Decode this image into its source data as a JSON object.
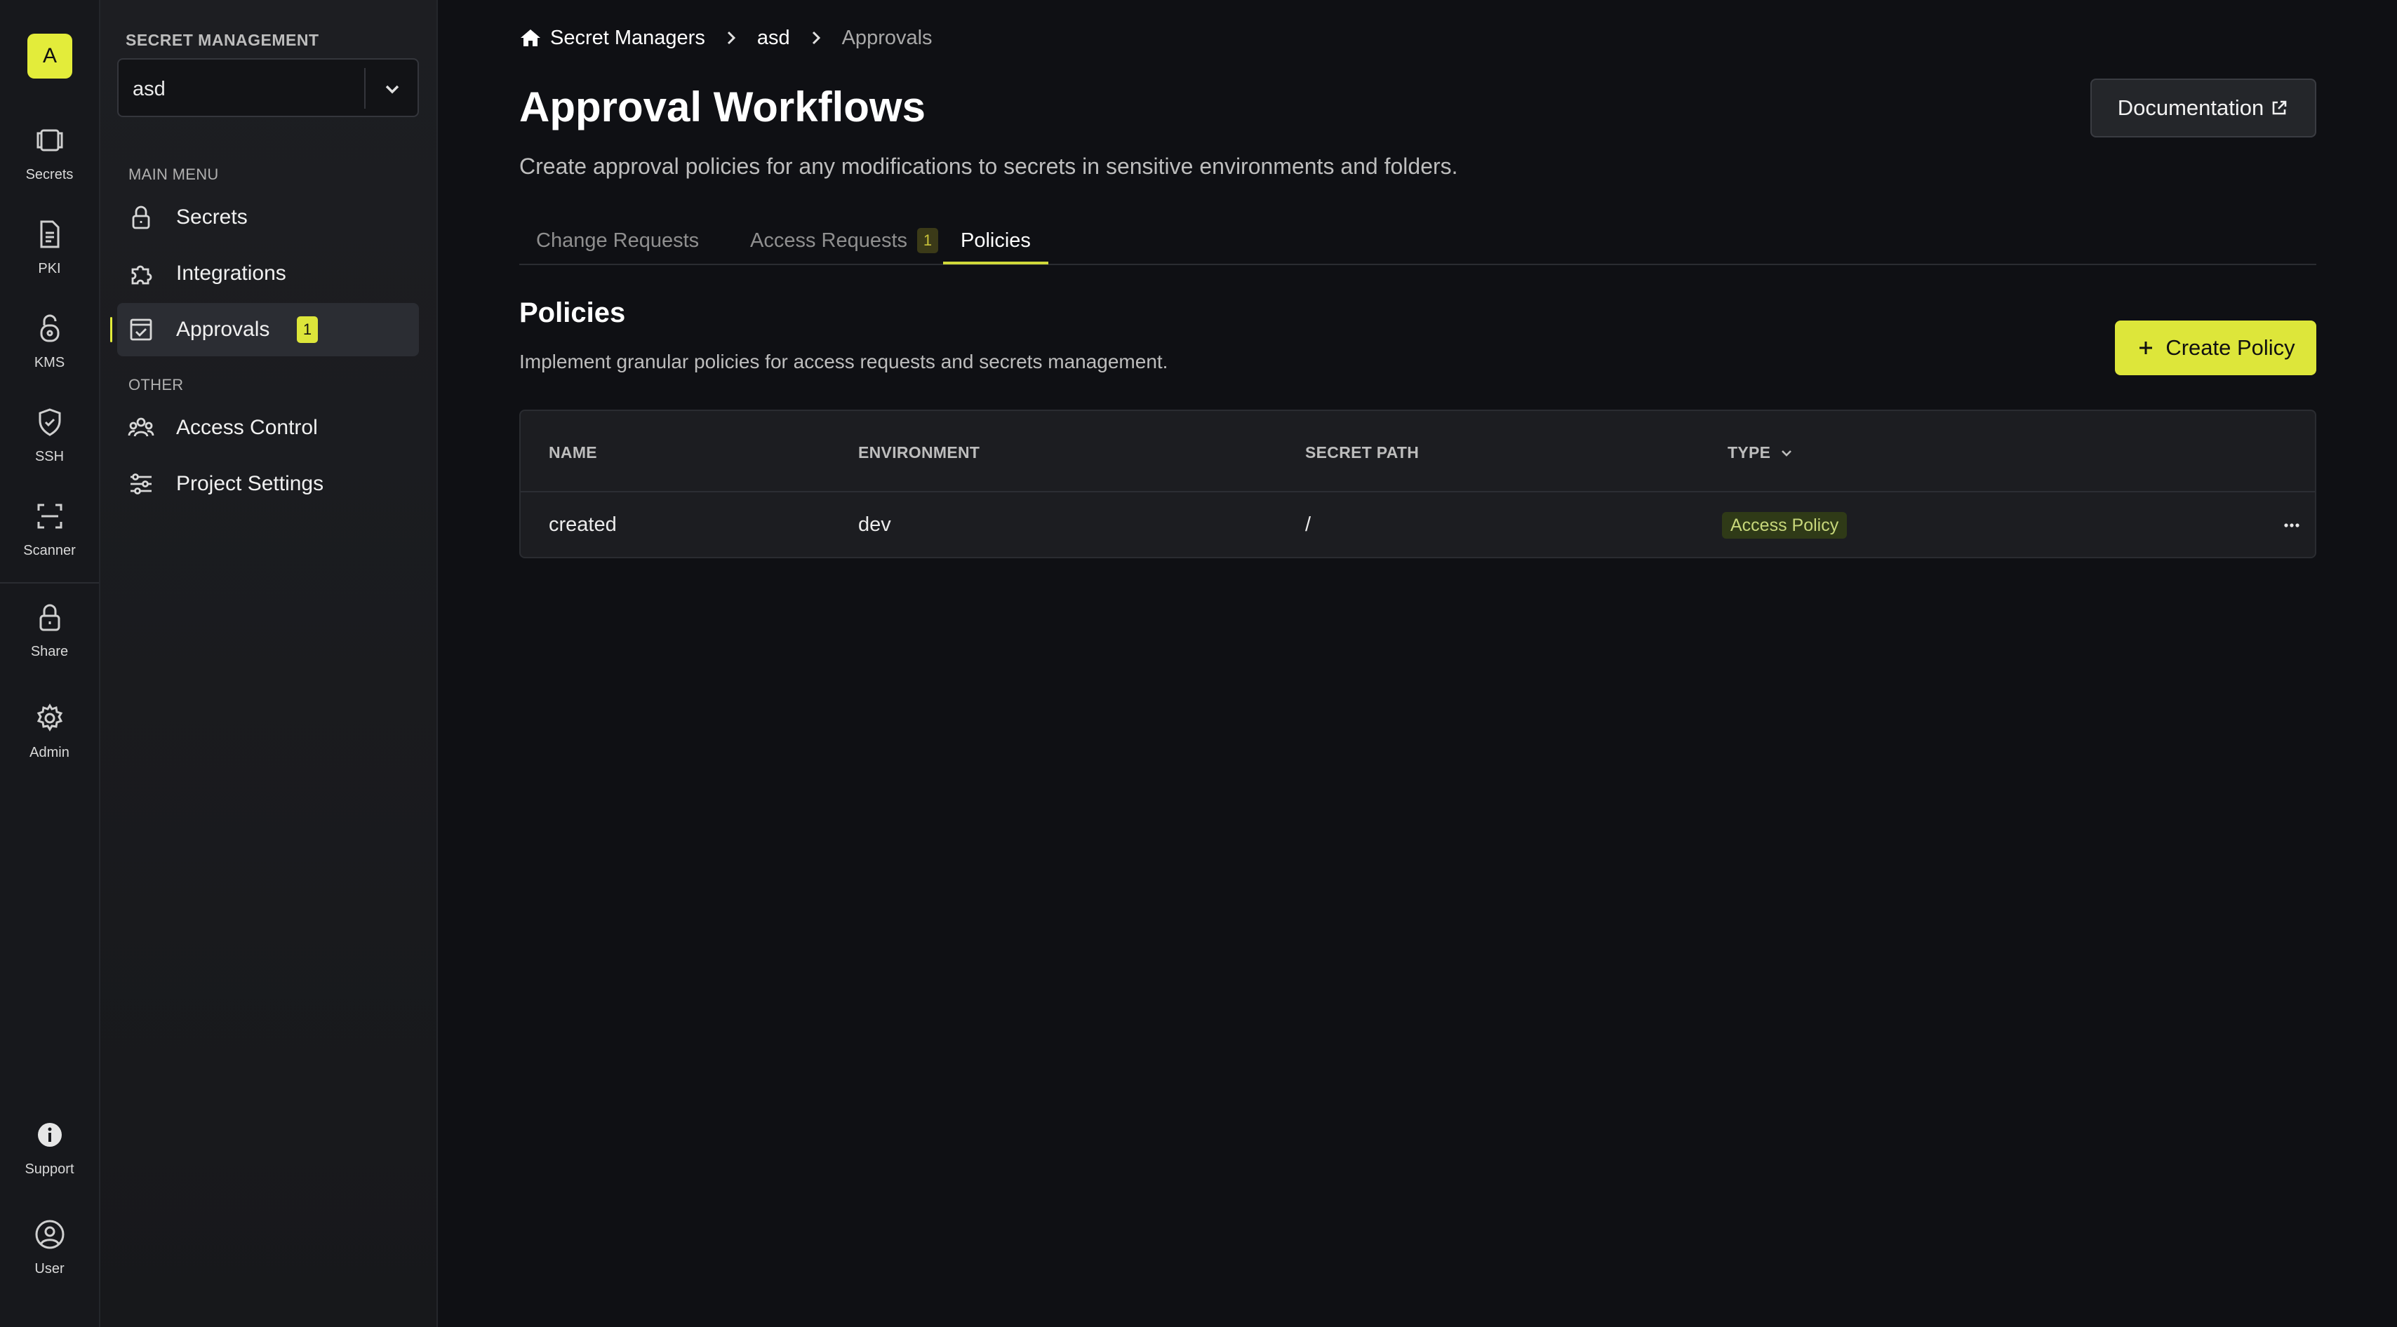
{
  "rail": {
    "org_initial": "A",
    "items": [
      {
        "label": "Secrets",
        "icon": "vault-icon"
      },
      {
        "label": "PKI",
        "icon": "document-icon"
      },
      {
        "label": "KMS",
        "icon": "lock-key-icon"
      },
      {
        "label": "SSH",
        "icon": "shield-check-icon"
      },
      {
        "label": "Scanner",
        "icon": "scan-icon"
      },
      {
        "label": "Share",
        "icon": "lock-icon"
      },
      {
        "label": "Admin",
        "icon": "gear-icon"
      },
      {
        "label": "Support",
        "icon": "info-icon"
      },
      {
        "label": "User",
        "icon": "user-icon"
      }
    ]
  },
  "sidebar": {
    "heading": "SECRET MANAGEMENT",
    "project": "asd",
    "main_menu_label": "MAIN MENU",
    "main_menu": [
      {
        "label": "Secrets",
        "icon": "lock-icon"
      },
      {
        "label": "Integrations",
        "icon": "puzzle-icon"
      },
      {
        "label": "Approvals",
        "icon": "checklist-icon",
        "badge": "1",
        "active": true
      }
    ],
    "other_label": "OTHER",
    "other": [
      {
        "label": "Access Control",
        "icon": "users-icon"
      },
      {
        "label": "Project Settings",
        "icon": "sliders-icon"
      }
    ]
  },
  "breadcrumb": {
    "root": "Secret Managers",
    "project": "asd",
    "current": "Approvals"
  },
  "header": {
    "title": "Approval Workflows",
    "subtitle": "Create approval policies for any modifications to secrets in sensitive environments and folders.",
    "doc_button": "Documentation"
  },
  "tabs": [
    {
      "label": "Change Requests"
    },
    {
      "label": "Access Requests",
      "badge": "1"
    },
    {
      "label": "Policies",
      "active": true
    }
  ],
  "policies": {
    "title": "Policies",
    "description": "Implement granular policies for access requests and secrets management.",
    "create_button": "Create Policy",
    "columns": [
      "NAME",
      "ENVIRONMENT",
      "SECRET PATH",
      "TYPE"
    ],
    "rows": [
      {
        "name": "created",
        "environment": "dev",
        "secret_path": "/",
        "type": "Access Policy"
      }
    ]
  },
  "colors": {
    "accent": "#dde63a",
    "background": "#0f1014",
    "sidebar": "#1d1e22",
    "pill_bg": "#2f3a17",
    "pill_text": "#c7d77a"
  }
}
